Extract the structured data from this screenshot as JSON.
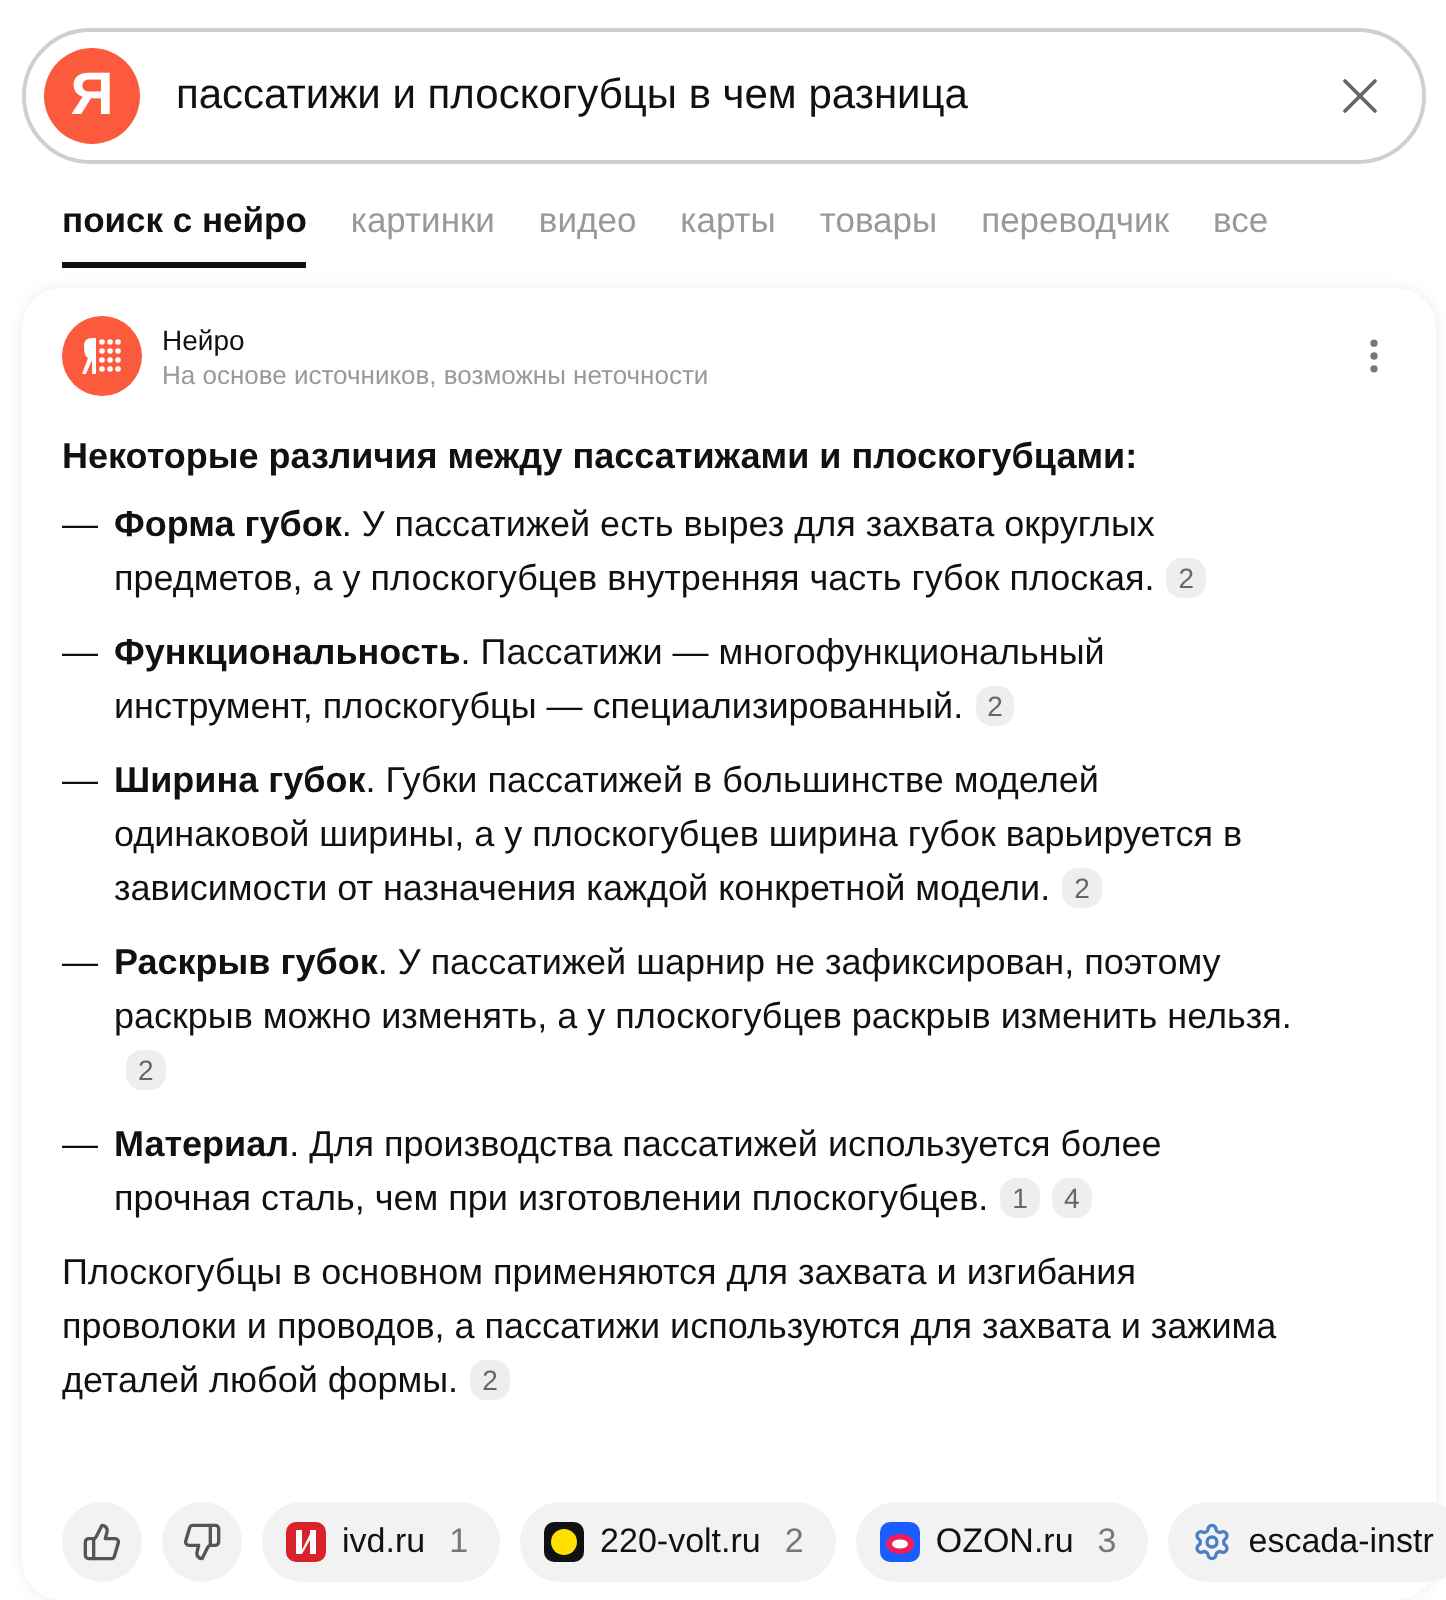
{
  "search": {
    "logo_letter": "Я",
    "value": "пассатижи и плоскогубцы в чем разница"
  },
  "tabs": [
    {
      "label": "поиск с нейро",
      "selected": true
    },
    {
      "label": "картинки",
      "selected": false
    },
    {
      "label": "видео",
      "selected": false
    },
    {
      "label": "карты",
      "selected": false
    },
    {
      "label": "товары",
      "selected": false
    },
    {
      "label": "переводчик",
      "selected": false
    },
    {
      "label": "все",
      "selected": false
    }
  ],
  "answer": {
    "source_name": "Нейро",
    "source_note": "На основе источников, возможны неточности",
    "heading": "Некоторые различия между пассатижами и плоскогубцами:",
    "items": [
      {
        "term": "Форма губок",
        "text": ". У пассатижей есть вырез для захвата округлых предметов, а у плоскогубцев внутренняя часть губок плоская.",
        "refs": [
          "2"
        ]
      },
      {
        "term": "Функциональность",
        "text": ". Пассатижи — многофункциональный инструмент, плоскогубцы — специализированный.",
        "refs": [
          "2"
        ]
      },
      {
        "term": "Ширина губок",
        "text": ". Губки пассатижей в большинстве моделей одинаковой ширины, а у плоскогубцев ширина губок варьируется в зависимости от назначения каждой конкретной модели.",
        "refs": [
          "2"
        ]
      },
      {
        "term": "Раскрыв губок",
        "text": ". У пассатижей шарнир не зафиксирован, поэтому раскрыв можно изменять, а у плоскогубцев раскрыв изменить нельзя.",
        "refs": [
          "2"
        ]
      },
      {
        "term": "Материал",
        "text": ". Для производства пассатижей используется более прочная сталь, чем при изготовлении плоскогубцев.",
        "refs": [
          "1",
          "4"
        ]
      }
    ],
    "dash": "—",
    "summary": "Плоскогубцы в основном применяются для захвата и изгибания проволоки и проводов, а пассатижи используются для захвата и зажима деталей любой формы.",
    "summary_refs": [
      "2"
    ],
    "sources": [
      {
        "kind": "ivd",
        "domain": "ivd.ru",
        "ref": "1"
      },
      {
        "kind": "volt",
        "domain": "220-volt.ru",
        "ref": "2"
      },
      {
        "kind": "ozon",
        "domain": "OZON.ru",
        "ref": "3"
      },
      {
        "kind": "escada",
        "domain": "escada-instr"
      }
    ]
  }
}
